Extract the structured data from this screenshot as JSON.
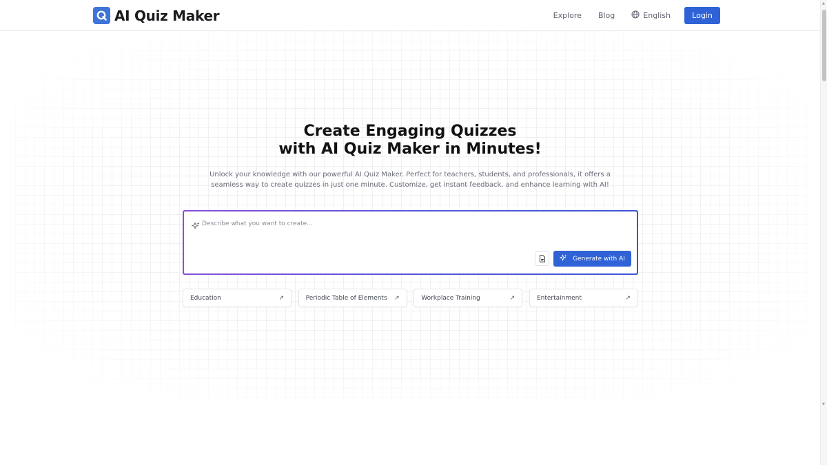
{
  "header": {
    "brand_name": "AI Quiz Maker",
    "nav": [
      {
        "label": "Explore"
      },
      {
        "label": "Blog"
      }
    ],
    "language": "English",
    "login_label": "Login"
  },
  "hero": {
    "title_line1": "Create Engaging Quizzes",
    "title_line2": "with AI Quiz Maker in Minutes!",
    "subtitle": "Unlock your knowledge with our powerful AI Quiz Maker. Perfect for teachers, students, and professionals, it offers a seamless way to create quizzes in just one minute. Customize, get instant feedback, and enhance learning with AI!"
  },
  "prompt": {
    "placeholder": "Describe what you want to create...",
    "value": "",
    "generate_label": "Generate with AI"
  },
  "suggestions": [
    {
      "label": "Education",
      "arrow": "↗"
    },
    {
      "label": "Periodic Table of Elements",
      "arrow": "↗"
    },
    {
      "label": "Workplace Training",
      "arrow": "↗"
    },
    {
      "label": "Entertainment",
      "arrow": "↗"
    }
  ],
  "colors": {
    "brand": "#3f73d8",
    "primary_button": "#2f62d6",
    "prompt_border_start": "#8a4fd8",
    "prompt_border_end": "#3b56d6"
  },
  "icons": {
    "logo": "q-logo-icon",
    "language": "globe-icon",
    "prompt": "sparkle-icon",
    "attach": "file-icon",
    "generate": "sparkle-icon",
    "suggestion": "arrow-up-right-icon"
  }
}
